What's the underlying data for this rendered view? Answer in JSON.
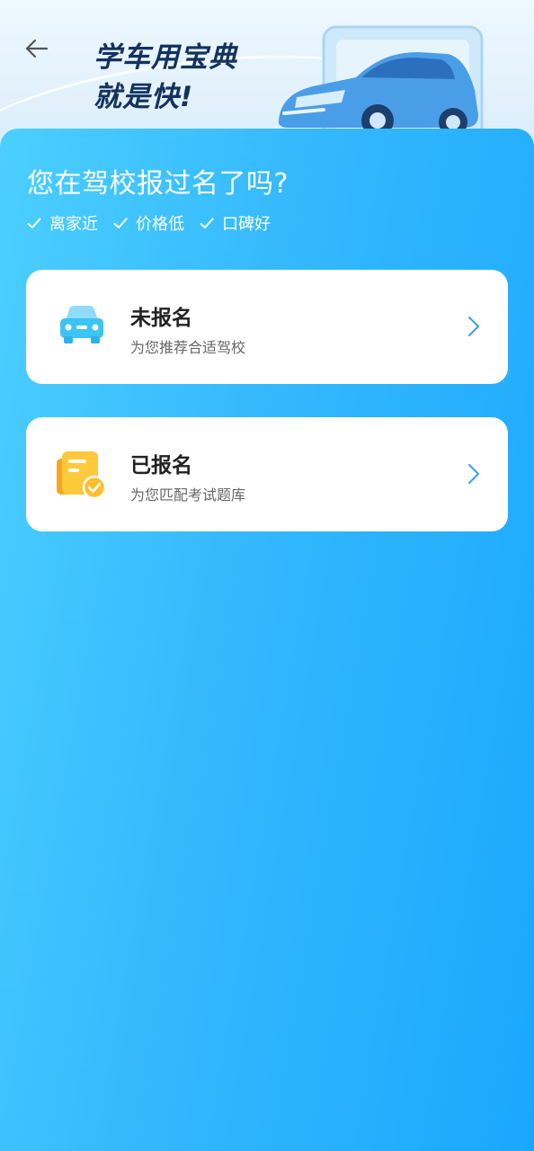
{
  "header": {
    "title_line1": "学车用宝典",
    "title_line2": "就是快!",
    "back_icon": "arrow-left-icon"
  },
  "main": {
    "question": "您在驾校报过名了吗?",
    "perks": [
      {
        "label": "离家近",
        "icon": "check-icon"
      },
      {
        "label": "价格低",
        "icon": "check-icon"
      },
      {
        "label": "口碑好",
        "icon": "check-icon"
      }
    ],
    "options": [
      {
        "title": "未报名",
        "subtitle": "为您推荐合适驾校",
        "icon": "car-icon",
        "icon_color": "#3cc4f5"
      },
      {
        "title": "已报名",
        "subtitle": "为您匹配考试题库",
        "icon": "document-check-icon",
        "icon_color": "#ffbe2e"
      }
    ]
  },
  "colors": {
    "panel_gradient_start": "#4ccfff",
    "panel_gradient_end": "#1aa8fd",
    "title_text": "#13325e",
    "chevron": "#3aa0e6"
  }
}
